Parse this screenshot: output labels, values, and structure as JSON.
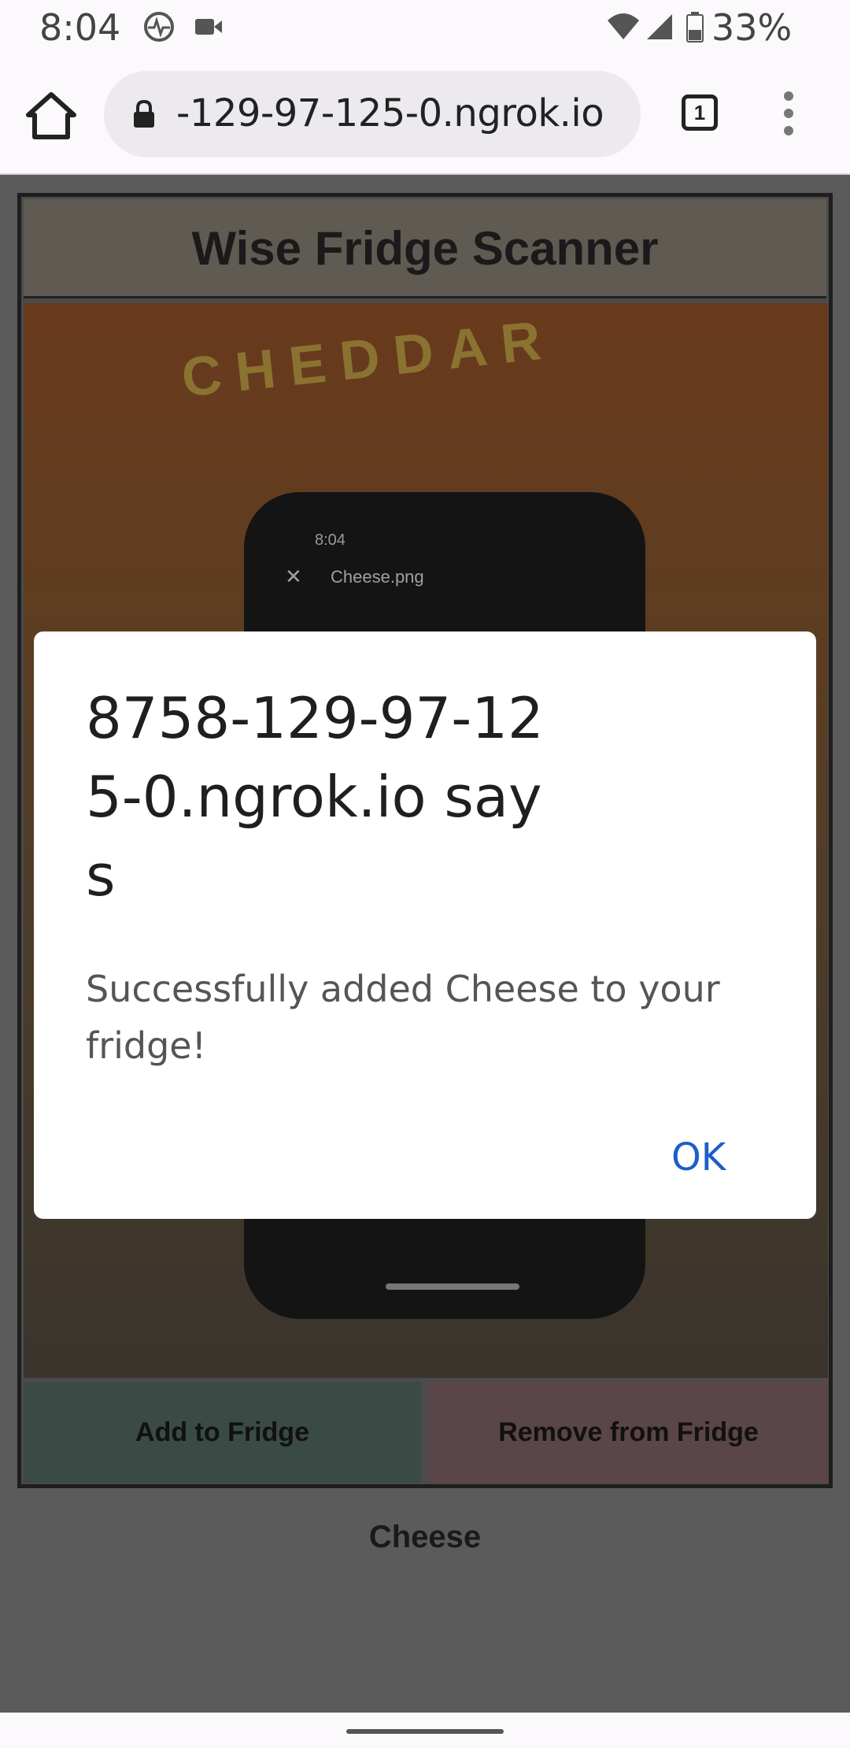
{
  "status_bar": {
    "time": "8:04",
    "battery": "33%",
    "icons": [
      "activity-icon",
      "video-icon",
      "wifi-icon",
      "signal-icon",
      "battery-icon"
    ]
  },
  "browser": {
    "url": "-129-97-125-0.ngrok.io",
    "tab_count": "1"
  },
  "page": {
    "title": "Wise Fridge Scanner",
    "camera_preview": {
      "bag_text": "CHEDDAR",
      "phone_time": "8:04",
      "phone_file": "Cheese.png"
    },
    "add_button": "Add to Fridge",
    "remove_button": "Remove from Fridge",
    "detected_item": "Cheese"
  },
  "dialog": {
    "title": "8758-129-97-125-0.ngrok.io says",
    "message": "Successfully added Cheese to your fridge!",
    "ok_label": "OK"
  },
  "colors": {
    "accent": "#1a5fc8",
    "add_button": "#3a4a44",
    "remove_button": "#5a4548"
  }
}
